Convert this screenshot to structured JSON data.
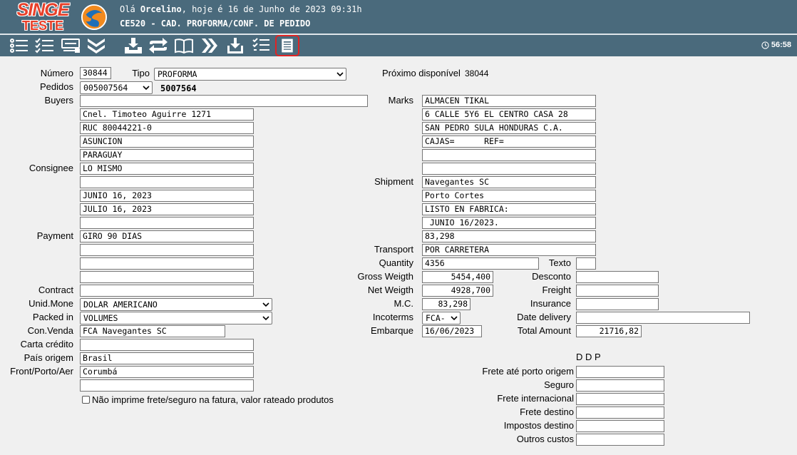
{
  "header": {
    "brand": "SINGE",
    "brand_sub": "TESTE",
    "greeting_prefix": "Olá ",
    "user": "Orcelino",
    "greeting_suffix": ", hoje é 16 de Junho de 2023 09:31h",
    "screen_title": "CE520 - CAD. PROFORMA/CONF. DE PEDIDO",
    "timer": "56:58"
  },
  "toolbar": {
    "buttons": [
      "list-icon",
      "checklist-icon",
      "keyboard-icon",
      "double-chevron-down-icon",
      "download-box-icon",
      "swap-icon",
      "book-icon",
      "double-chevron-right-icon",
      "import-icon",
      "task-list-icon",
      "document-icon"
    ],
    "active": "document-icon"
  },
  "form": {
    "numero": {
      "label": "Número",
      "value": "30844"
    },
    "tipo": {
      "label": "Tipo",
      "value": "PROFORMA"
    },
    "proximo": {
      "label": "Próximo disponível",
      "value": "38044"
    },
    "pedidos": {
      "label": "Pedidos",
      "value": "005007564",
      "display": "5007564"
    },
    "buyers": {
      "label": "Buyers",
      "lines": [
        "",
        "Cnel. Timoteo Aguirre 1271",
        "RUC 80044221-0",
        "ASUNCION",
        "PARAGUAY"
      ]
    },
    "consignee": {
      "label": "Consignee",
      "lines": [
        "LO MISMO",
        "",
        "JUNIO 16, 2023",
        "JULIO 16, 2023",
        ""
      ]
    },
    "payment": {
      "label": "Payment",
      "lines": [
        "GIRO 90 DIAS",
        "",
        "",
        ""
      ]
    },
    "contract": {
      "label": "Contract",
      "value": ""
    },
    "unid_mone": {
      "label": "Unid.Mone",
      "value": "DOLAR AMERICANO"
    },
    "packed_in": {
      "label": "Packed in",
      "value": "VOLUMES"
    },
    "con_venda": {
      "label": "Con.Venda",
      "value": "FCA Navegantes SC"
    },
    "carta_credito": {
      "label": "Carta crédito",
      "value": ""
    },
    "pais_origem": {
      "label": "País origem",
      "value": "Brasil"
    },
    "front_porto": {
      "label": "Front/Porto/Aer",
      "lines": [
        "Corumbá",
        ""
      ]
    },
    "nao_imprime": {
      "label": "Não imprime frete/seguro na fatura, valor rateado produtos"
    },
    "marks": {
      "label": "Marks",
      "lines": [
        "ALMACEN TIKAL",
        "6 CALLE 5Y6 EL CENTRO CASA 28",
        "SAN PEDRO SULA HONDURAS C.A.",
        "CAJAS=      REF=",
        "",
        ""
      ]
    },
    "shipment": {
      "label": "Shipment",
      "lines": [
        "Navegantes SC",
        "Porto Cortes",
        "LISTO EN FABRICA:",
        " JUNIO 16/2023.",
        "83,298"
      ]
    },
    "transport": {
      "label": "Transport",
      "value": "POR CARRETERA"
    },
    "quantity": {
      "label": "Quantity",
      "value": "4356"
    },
    "texto": {
      "label": "Texto",
      "value": ""
    },
    "gross_weigth": {
      "label": "Gross Weigth",
      "value": "5454,400"
    },
    "desconto": {
      "label": "Desconto",
      "value": ""
    },
    "net_weigth": {
      "label": "Net Weigth",
      "value": "4928,700"
    },
    "freight": {
      "label": "Freight",
      "value": ""
    },
    "mc": {
      "label": "M.C.",
      "value": "83,298"
    },
    "insurance": {
      "label": "Insurance",
      "value": ""
    },
    "incoterms": {
      "label": "Incoterms",
      "value": "FCA-"
    },
    "date_delivery": {
      "label": "Date delivery",
      "value": ""
    },
    "embarque": {
      "label": "Embarque",
      "value": "16/06/2023"
    },
    "total_amount": {
      "label": "Total Amount",
      "value": "21716,82"
    },
    "ddp": {
      "title": "D D P",
      "frete_porto_origem": {
        "label": "Frete até porto origem",
        "value": ""
      },
      "seguro": {
        "label": "Seguro",
        "value": ""
      },
      "frete_internacional": {
        "label": "Frete internacional",
        "value": ""
      },
      "frete_destino": {
        "label": "Frete destino",
        "value": ""
      },
      "impostos_destino": {
        "label": "Impostos destino",
        "value": ""
      },
      "outros_custos": {
        "label": "Outros custos",
        "value": ""
      }
    }
  }
}
